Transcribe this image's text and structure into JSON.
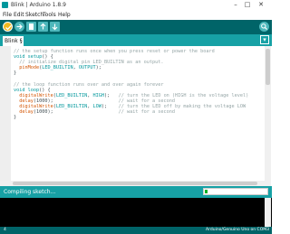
{
  "window": {
    "title": "Blink | Arduino 1.8.9"
  },
  "menu": {
    "items": [
      "File",
      "Edit",
      "Sketch",
      "Tools",
      "Help"
    ]
  },
  "toolbar": {
    "buttons": [
      "checkmark-icon",
      "arrow-right-icon",
      "new-file-icon",
      "arrow-up-icon",
      "arrow-down-icon"
    ],
    "serial_monitor": "magnifier-icon"
  },
  "tabs": {
    "active_label": "Blink §",
    "menu_glyph": "▾"
  },
  "editor": {
    "lines": [
      "// the setup function runs once when you press reset or power the board",
      "void setup() {",
      "  // initialize digital pin LED_BUILTIN as an output.",
      "  pinMode(LED_BUILTIN, OUTPUT);",
      "}",
      "",
      "// the loop function runs over and over again forever",
      "void loop() {",
      "  digitalWrite(LED_BUILTIN, HIGH);   // turn the LED on (HIGH is the voltage level)",
      "  delay(1000);                       // wait for a second",
      "  digitalWrite(LED_BUILTIN, LOW);    // turn the LED off by making the voltage LOW",
      "  delay(1000);                       // wait for a second",
      "}"
    ]
  },
  "status": {
    "text": "Compiling sketch...",
    "progress": 0.04
  },
  "footer": {
    "line_number": "4",
    "board": "Arduino/Genuino Uno on COM3"
  },
  "colors": {
    "toolbar": "#006468",
    "tabbar": "#17a1a5",
    "comment": "#95a5a6",
    "keyword": "#00979c",
    "function": "#d35400",
    "constant": "#00979c",
    "text": "#434f54"
  }
}
